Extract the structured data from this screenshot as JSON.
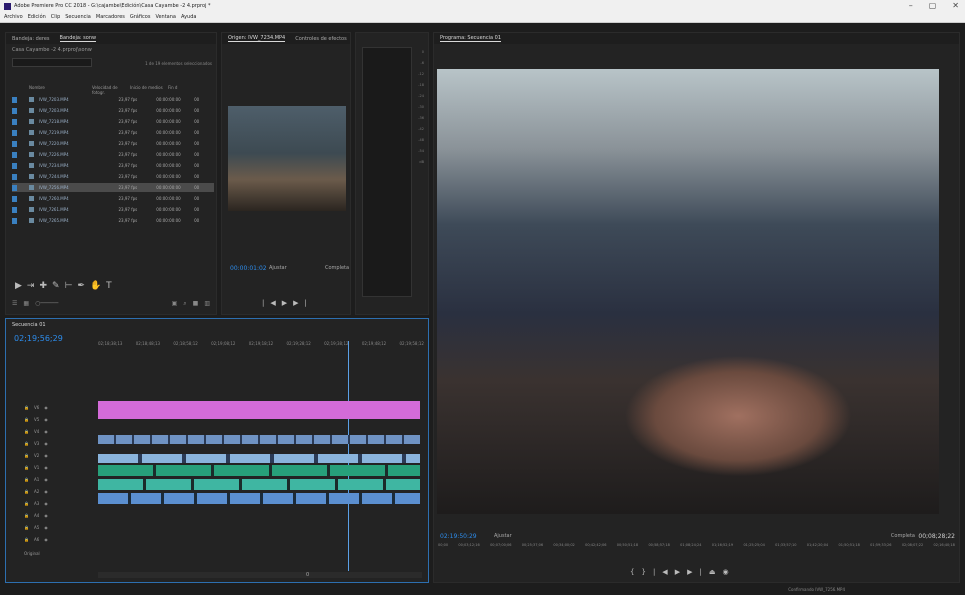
{
  "window": {
    "title": "Adobe Premiere Pro CC 2018 - G:\\cajambe\\Edición\\Casa Cayambe -2 4.prproj *",
    "controls": [
      "–",
      "▢",
      "✕"
    ]
  },
  "menu": [
    "Archivo",
    "Edición",
    "Clip",
    "Secuencia",
    "Marcadores",
    "Gráficos",
    "Ventana",
    "Ayuda"
  ],
  "project": {
    "tabs": [
      {
        "label": "Bandeja: deres"
      },
      {
        "label": "Bandeja: sonw"
      }
    ],
    "path": "Casa Cayambe -2 4.prproj\\sonw",
    "selection_count": "1 de 19 elementos seleccionados",
    "columns": [
      "Nombre",
      "Velocidad de fotogr.",
      "Inicio de medios",
      "Fin d"
    ],
    "rows": [
      {
        "name": "IVW_7203.MP4",
        "rate": "23,97 fps",
        "start": "00:00:00:00",
        "end": "00"
      },
      {
        "name": "IVW_7203.MP4",
        "rate": "23,97 fps",
        "start": "00:00:00:00",
        "end": "00"
      },
      {
        "name": "IVW_7218.MP4",
        "rate": "23,97 fps",
        "start": "00:00:00:00",
        "end": "00"
      },
      {
        "name": "IVW_7219.MP4",
        "rate": "23,97 fps",
        "start": "00:00:00:00",
        "end": "00"
      },
      {
        "name": "IVW_7220.MP4",
        "rate": "23,97 fps",
        "start": "00:00:00:00",
        "end": "00"
      },
      {
        "name": "IVW_7226.MP4",
        "rate": "23,97 fps",
        "start": "00:00:00:00",
        "end": "00"
      },
      {
        "name": "IVW_7234.MP4",
        "rate": "23,97 fps",
        "start": "00:00:00:00",
        "end": "00"
      },
      {
        "name": "IVW_7244.MP4",
        "rate": "23,97 fps",
        "start": "00:00:00:00",
        "end": "00"
      },
      {
        "name": "IVW_7256.MP4",
        "rate": "23,97 fps",
        "start": "00:00:00:00",
        "end": "00"
      },
      {
        "name": "IVW_7260.MP4",
        "rate": "23,97 fps",
        "start": "00:00:00:00",
        "end": "00"
      },
      {
        "name": "IVW_7261.MP4",
        "rate": "23,97 fps",
        "start": "00:00:00:00",
        "end": "00"
      },
      {
        "name": "IVW_7265.MP4",
        "rate": "23,97 fps",
        "start": "00:00:00:00",
        "end": "00"
      }
    ]
  },
  "source": {
    "tabs": [
      {
        "label": "Origen: IVW_7234.MP4"
      },
      {
        "label": "Controles de efectos"
      }
    ],
    "timecode": "00:00:01:02",
    "fit": "Ajustar",
    "quality": "Completa"
  },
  "meter": {
    "scale": [
      "0",
      "-6",
      "-12",
      "-18",
      "-24",
      "-30",
      "-36",
      "-42",
      "-48",
      "-54",
      "dB"
    ]
  },
  "program": {
    "tab": "Programa: Secuencia 01",
    "timecode": "02:19:50:29",
    "fit": "Ajustar",
    "quality": "Completa",
    "duration": "00;08;28;22",
    "ruler": [
      "00;00",
      "00;03;12;16",
      "00;07;00;06",
      "00;25;37;06",
      "00;34;00;02",
      "00;42;42;06",
      "00;50;51;18",
      "00;58;57;18",
      "01;08;24;24",
      "01;16;52;19",
      "01;25;25;04",
      "01;33;57;10",
      "01;42;20;04",
      "01;50;51;18",
      "01;59;33;26",
      "02;08;07;22",
      "02;16;40;18"
    ]
  },
  "timeline": {
    "title": "Secuencia 01",
    "timecode": "02;19;56;29",
    "ruler": [
      "02;18;38;13",
      "02;18;48;13",
      "02;18;58;12",
      "02;19;08;12",
      "02;19;18;12",
      "02;19;28;12",
      "02;19;38;12",
      "02;19;48;12",
      "02;19;58;12"
    ],
    "tracks": [
      "V6",
      "V5",
      "V4",
      "V3",
      "V2",
      "V1",
      "A1",
      "A2",
      "A3",
      "A4",
      "A5",
      "A6"
    ],
    "master": "Original",
    "zoom_marks": [
      "0",
      "0"
    ]
  },
  "status": {
    "message": "Confirmando IVW_7256.MP4"
  }
}
